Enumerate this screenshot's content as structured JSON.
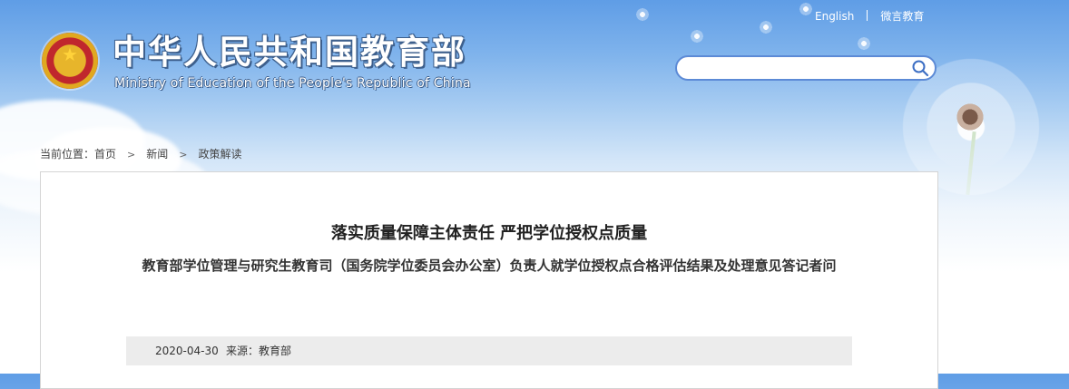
{
  "header": {
    "title_cn": "中华人民共和国教育部",
    "title_en": "Ministry of Education of the People's Republic of China"
  },
  "top_links": {
    "english": "English",
    "weibo": "微言教育"
  },
  "search": {
    "placeholder": "",
    "value": ""
  },
  "breadcrumb": {
    "label": "当前位置：",
    "items": [
      "首页",
      "新闻",
      "政策解读"
    ]
  },
  "article": {
    "title": "落实质量保障主体责任 严把学位授权点质量",
    "subtitle": "教育部学位管理与研究生教育司（国务院学位委员会办公室）负责人就学位授权点合格评估结果及处理意见答记者问",
    "date": "2020-04-30",
    "source": "来源：教育部"
  },
  "colors": {
    "accent": "#5c8ad6",
    "emblem_red": "#c0272d",
    "emblem_gold": "#e7b52b"
  },
  "icons": {
    "search": "search-icon",
    "emblem": "national-emblem-icon"
  }
}
